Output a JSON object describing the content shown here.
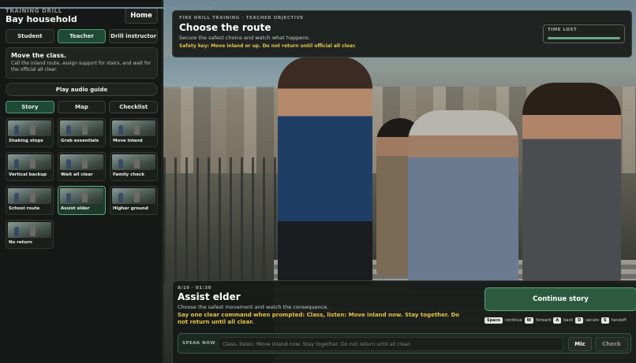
{
  "sidebar": {
    "eyebrow": "TRAINING DRILL",
    "title": "Bay household",
    "home_label": "Home",
    "roles": [
      "Student",
      "Teacher",
      "Drill instructor"
    ],
    "active_role": "Teacher",
    "brief": {
      "title": "Move the class.",
      "text": "Call the inland route, assign support for stairs, and wait for the official all clear."
    },
    "audio_label": "Play audio guide",
    "tabs": [
      "Story",
      "Map",
      "Checklist"
    ],
    "active_tab": "Story",
    "scenes": [
      "Shaking stops",
      "Grab essentials",
      "Move inland",
      "Vertical backup",
      "Wait all clear",
      "Family check",
      "School route",
      "Assist elder",
      "Higher ground",
      "No return"
    ],
    "active_scene": "Assist elder"
  },
  "objective": {
    "eyebrow": "FIRE DRILL TRAINING · TEACHER OBJECTIVE",
    "title": "Choose the route",
    "subtitle": "Secure the safest choice and watch what happens.",
    "safety_key": "Safety key: Move inland or up. Do not return until official all clear.",
    "time_lost_label": "TIME LOST",
    "time_lost_fraction": 0.0
  },
  "step": {
    "meta": "8/10 · 01:30",
    "title": "Assist elder",
    "subtitle": "Choose the safest movement and watch the consequence.",
    "command": "Say one clear command when prompted: Class, listen: Move inland now. Stay together. Do not return until all clear.",
    "continue_label": "Continue story",
    "shortcuts": [
      {
        "key": "Space",
        "label": "continue"
      },
      {
        "key": "W",
        "label": "forward"
      },
      {
        "key": "A",
        "label": "back"
      },
      {
        "key": "D",
        "label": "secure"
      },
      {
        "key": "S",
        "label": "handoff"
      }
    ],
    "speak_label": "SPEAK NOW",
    "speak_placeholder": "Class, listen: Move inland now. Stay together. Do not return until all clear.",
    "mic_label": "Mic",
    "check_label": "Check"
  },
  "colors": {
    "accent": "#1f4a35",
    "accent_border": "#4e9a6f",
    "warning": "#e7c24a"
  }
}
